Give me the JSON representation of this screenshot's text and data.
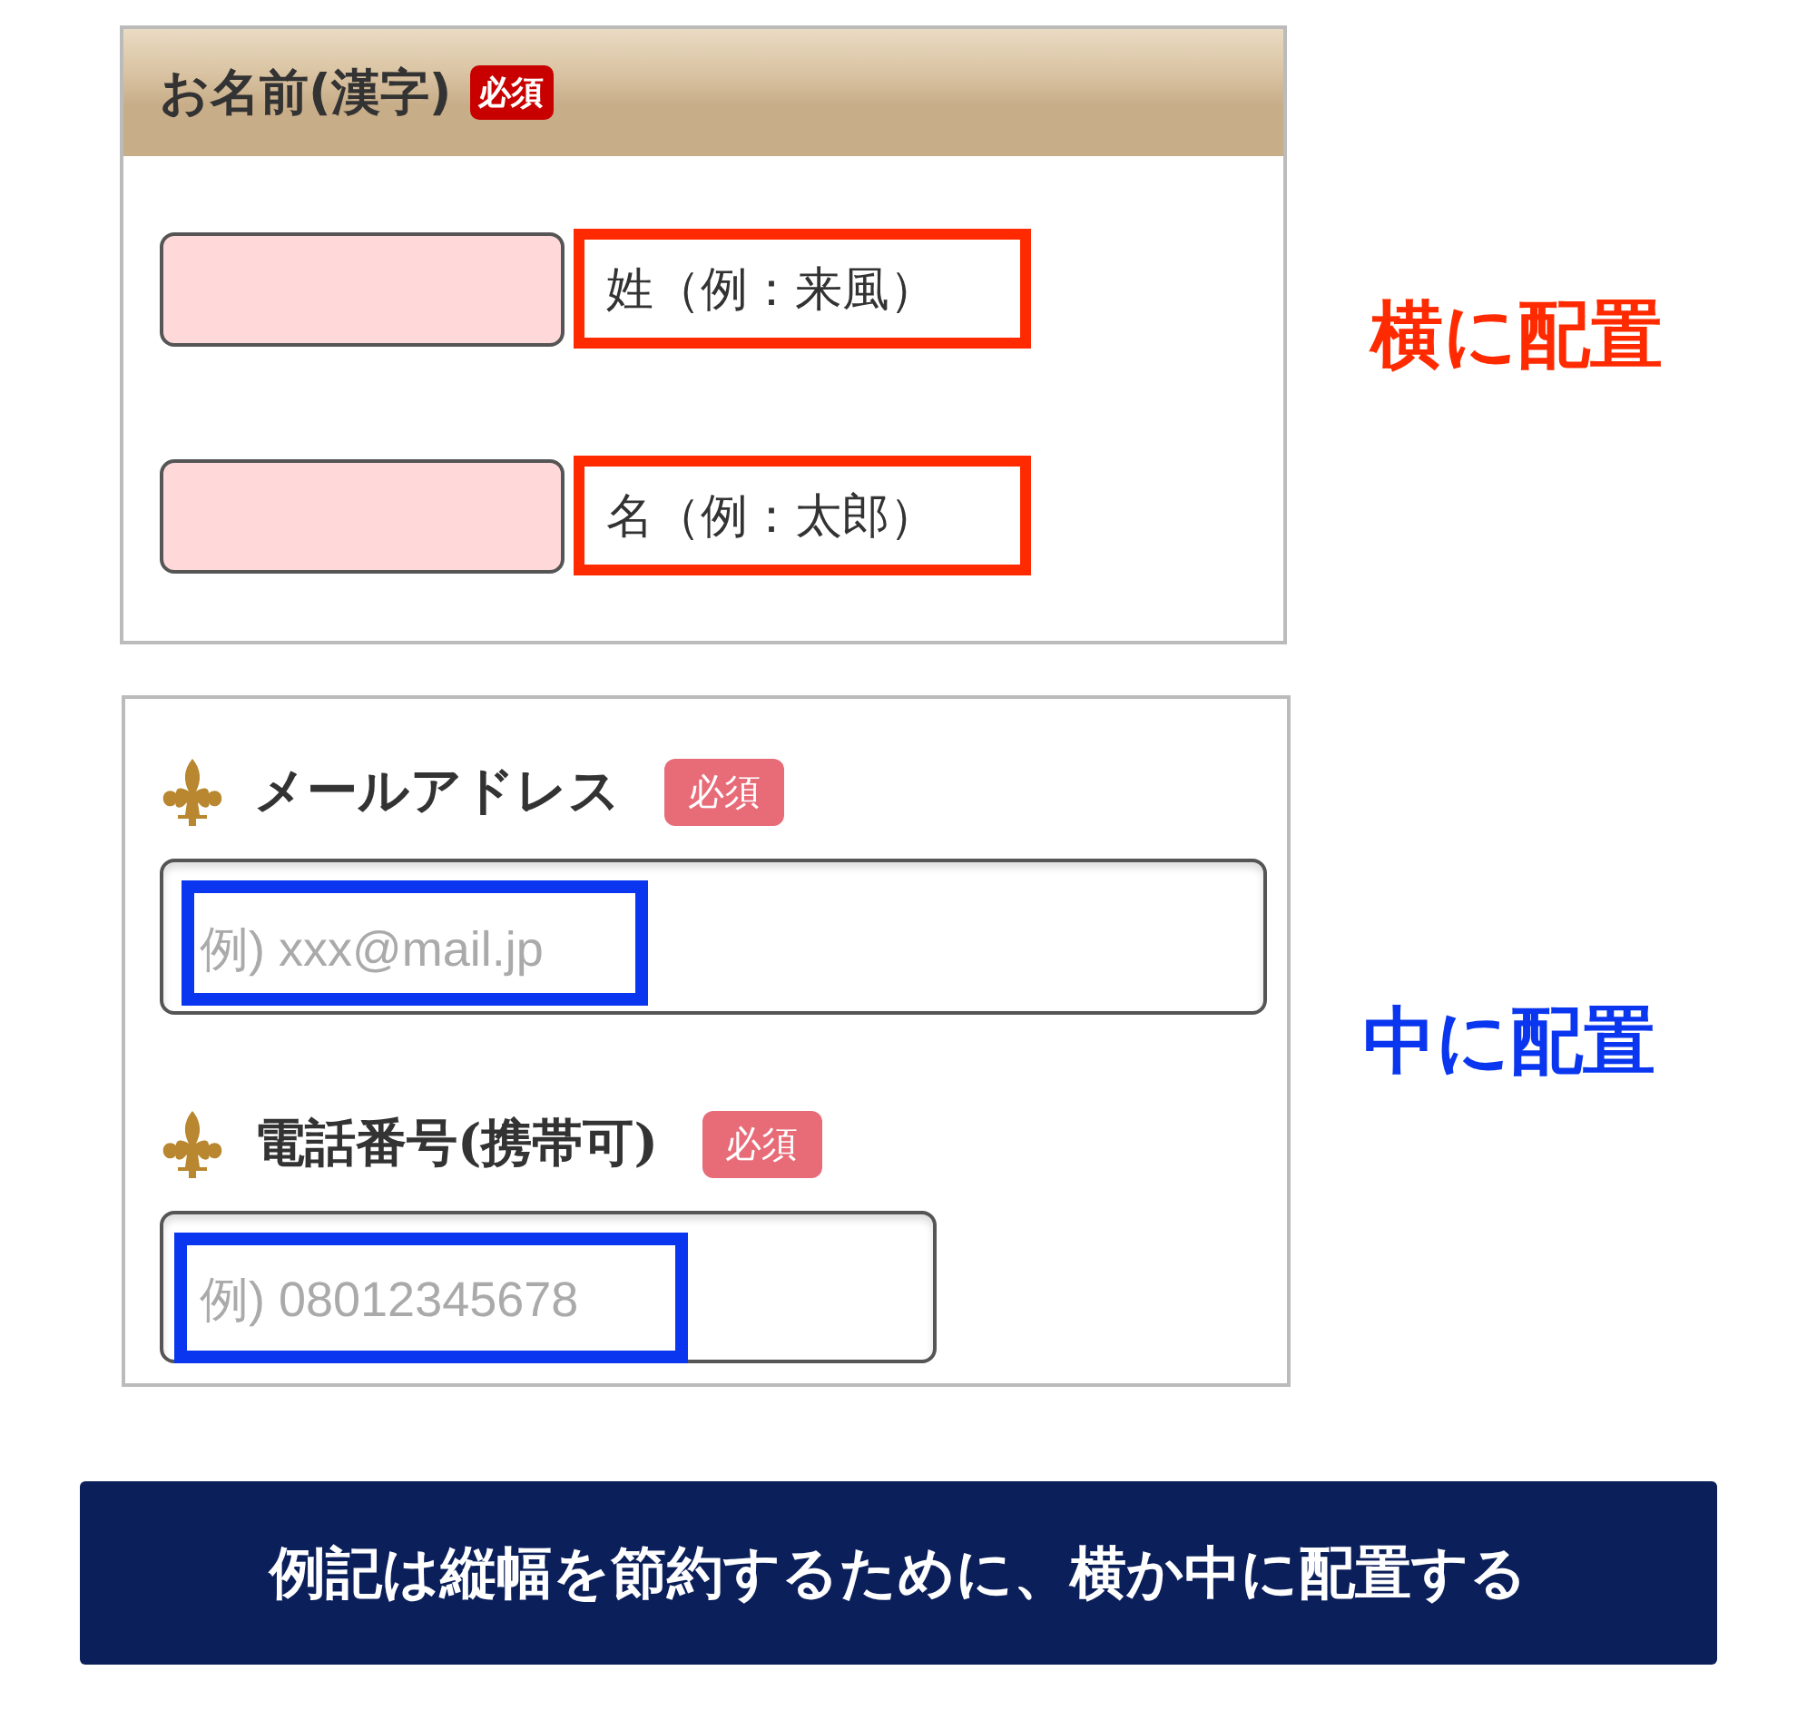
{
  "name_section": {
    "title": "お名前(漢字)",
    "badge": "必須",
    "fields": [
      {
        "hint": "姓（例：来風）"
      },
      {
        "hint": "名（例：太郎）"
      }
    ]
  },
  "contact_section": {
    "fields": [
      {
        "label": "メールアドレス",
        "badge": "必須",
        "placeholder": "例) xxx@mail.jp",
        "kind": "wide"
      },
      {
        "label": "電話番号(携帯可)",
        "badge": "必須",
        "placeholder": "例) 08012345678",
        "kind": "short"
      }
    ]
  },
  "annotations": [
    {
      "text": "横に配置",
      "color": "#ff2a00"
    },
    {
      "text": "中に配置",
      "color": "#0a36f0"
    }
  ],
  "banner": "例記は縦幅を節約するために、横か中に配置する"
}
